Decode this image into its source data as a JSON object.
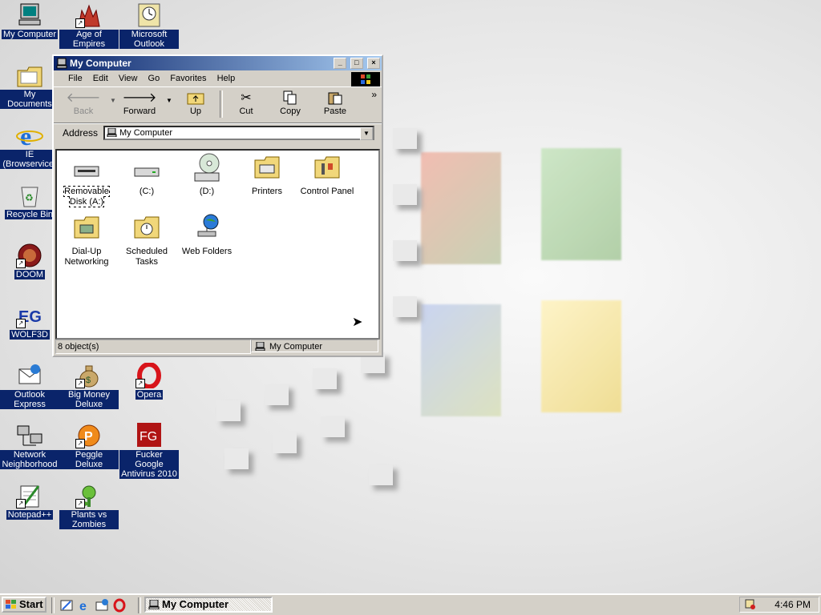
{
  "desktop": {
    "icons": [
      {
        "label": "My Computer",
        "icon": "computer-icon"
      },
      {
        "label": "Age of Empires",
        "icon": "age-of-empires-icon"
      },
      {
        "label": "Microsoft Outlook",
        "icon": "outlook-icon"
      },
      {
        "label": "My Documents",
        "icon": "folder-icon"
      },
      {
        "label": "IE (Browservice)",
        "icon": "ie-icon"
      },
      {
        "label": "Recycle Bin",
        "icon": "recycle-bin-icon"
      },
      {
        "label": "DOOM",
        "icon": "doom-icon"
      },
      {
        "label": "WOLF3D",
        "icon": "wolf3d-icon"
      },
      {
        "label": "Outlook Express",
        "icon": "outlook-express-icon"
      },
      {
        "label": "Big Money Deluxe",
        "icon": "money-bag-icon"
      },
      {
        "label": "Opera",
        "icon": "opera-icon"
      },
      {
        "label": "Network Neighborhood",
        "icon": "network-icon"
      },
      {
        "label": "Peggle Deluxe",
        "icon": "peggle-icon"
      },
      {
        "label": "Fucker Google Antivirus 2010",
        "icon": "antivirus-icon"
      },
      {
        "label": "Notepad++",
        "icon": "notepad-icon"
      },
      {
        "label": "Plants vs Zombies",
        "icon": "plants-icon"
      }
    ]
  },
  "window": {
    "title": "My Computer",
    "buttons": {
      "minimize": "_",
      "maximize": "□",
      "close": "×"
    },
    "menu": [
      "File",
      "Edit",
      "View",
      "Go",
      "Favorites",
      "Help"
    ],
    "toolbar": [
      {
        "label": "Back",
        "icon": "back-arrow-icon",
        "enabled": false
      },
      {
        "label": "Forward",
        "icon": "forward-arrow-icon",
        "enabled": true
      },
      {
        "label": "Up",
        "icon": "up-folder-icon",
        "enabled": true
      },
      {
        "label": "Cut",
        "icon": "scissors-icon",
        "enabled": true
      },
      {
        "label": "Copy",
        "icon": "copy-icon",
        "enabled": true
      },
      {
        "label": "Paste",
        "icon": "paste-icon",
        "enabled": true
      }
    ],
    "toolbar_more": "»",
    "address": {
      "label": "Address",
      "value": "My Computer"
    },
    "items": [
      {
        "label": "Removable Disk (A:)",
        "icon": "floppy-drive-icon",
        "focused": true
      },
      {
        "label": "(C:)",
        "icon": "hard-drive-icon",
        "focused": false
      },
      {
        "label": "(D:)",
        "icon": "cd-drive-icon",
        "focused": false
      },
      {
        "label": "Printers",
        "icon": "printers-folder-icon",
        "focused": false
      },
      {
        "label": "Control Panel",
        "icon": "control-panel-icon",
        "focused": false
      },
      {
        "label": "Dial-Up Networking",
        "icon": "dialup-icon",
        "focused": false
      },
      {
        "label": "Scheduled Tasks",
        "icon": "scheduled-tasks-icon",
        "focused": false
      },
      {
        "label": "Web Folders",
        "icon": "web-folders-icon",
        "focused": false
      }
    ],
    "status": {
      "count": "8 object(s)",
      "location": "My Computer"
    }
  },
  "taskbar": {
    "start_label": "Start",
    "task_label": "My Computer",
    "clock": "4:46 PM"
  },
  "colors": {
    "titlebar": "#0a246a",
    "face": "#d4d0c8",
    "selection": "#0a246a"
  }
}
